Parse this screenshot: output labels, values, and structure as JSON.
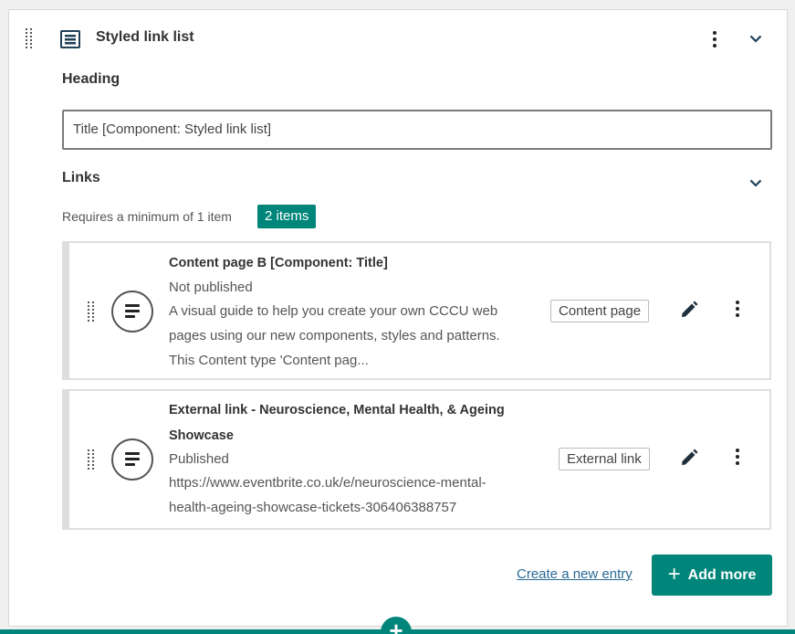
{
  "component": {
    "title": "Styled link list",
    "icon": "list-component-icon"
  },
  "heading": {
    "label": "Heading",
    "value": "Title [Component: Styled link list]"
  },
  "links": {
    "label": "Links",
    "requirement": "Requires a minimum of 1 item",
    "count_badge": "2 items",
    "items": [
      {
        "title": "Content page B [Component: Title]",
        "status": "Not published",
        "description_lines": [
          "A visual guide to help you create your own CCCU web",
          "pages using our new components, styles and patterns.",
          "This Content type 'Content pag..."
        ],
        "type": "Content page"
      },
      {
        "title_lines": [
          "External link - Neuroscience, Mental Health, & Ageing",
          "Showcase"
        ],
        "status": "Published",
        "description_lines": [
          "https://www.eventbrite.co.uk/e/neuroscience-mental-",
          "health-ageing-showcase-tickets-306406388757"
        ],
        "type": "External link"
      }
    ]
  },
  "actions": {
    "create_new": "Create a new entry",
    "add_more": "Add more",
    "add_more_icon": "+",
    "bottom_add_icon": "+"
  },
  "colors": {
    "accent": "#00857a",
    "link": "#2b6a96"
  }
}
